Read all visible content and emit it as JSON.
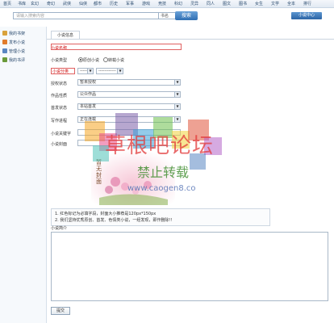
{
  "nav": [
    "首页",
    "书库",
    "玄幻",
    "奇幻",
    "武侠",
    "仙侠",
    "都市",
    "历史",
    "军事",
    "游戏",
    "竞技",
    "科幻",
    "灵异",
    "同人",
    "图文",
    "图书",
    "女生",
    "文学",
    "全本",
    "排行"
  ],
  "search": {
    "placeholder": "请输入搜索内容",
    "category": "书名",
    "button": "搜索"
  },
  "novel_center": "小说中心",
  "sidebar": [
    {
      "label": "我的书架",
      "icon": "bookshelf-icon",
      "color": "#d9a23a"
    },
    {
      "label": "发布小说",
      "icon": "publish-icon",
      "color": "#e07b2c"
    },
    {
      "label": "管理小说",
      "icon": "manage-icon",
      "color": "#5a86c2"
    },
    {
      "label": "我的书评",
      "icon": "review-icon",
      "color": "#6a9a3a"
    }
  ],
  "tab": "小说信息",
  "form": {
    "name_label": "小说名称",
    "type_label": "小说类型",
    "type_original": "原创小说",
    "type_repost": "转载小说",
    "category_label": "小说分类",
    "category_value": "-----",
    "subcategory_value": "------------",
    "auth_label": "授权状态",
    "auth_value": "暂未授权",
    "nature_label": "作品性质",
    "nature_value": "公众作品",
    "first_label": "首发状态",
    "first_value": "本站首发",
    "progress_label": "写作进程",
    "progress_value": "正在连载",
    "keywords_label": "小说关键字",
    "cover_label": "小说封面",
    "note1": "1. 红色标记为必填字段，封面大小推荐是120px*150px",
    "note2": "2. 我们坚持优秀原创、首发、色情类小说，一经发现，即作删除!!",
    "intro_label": "小说简介",
    "submit": "提交"
  },
  "cover_placeholder": "暂无封面",
  "watermark": {
    "title": "草根吧论坛",
    "subtitle": "禁止转载",
    "url": "www.caogen8.co"
  }
}
